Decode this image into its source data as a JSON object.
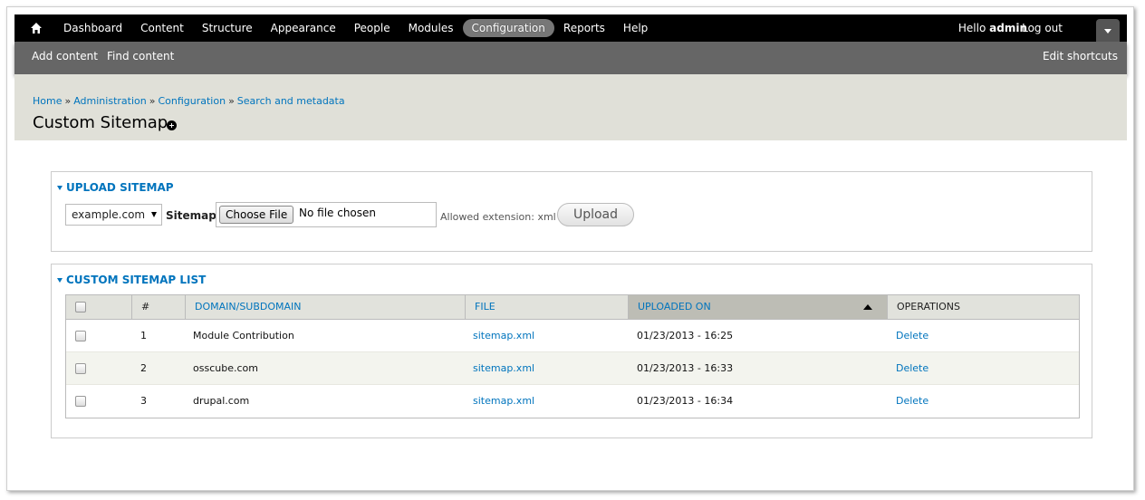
{
  "toolbar": {
    "menu": [
      {
        "label": "Dashboard",
        "active": false
      },
      {
        "label": "Content",
        "active": false
      },
      {
        "label": "Structure",
        "active": false
      },
      {
        "label": "Appearance",
        "active": false
      },
      {
        "label": "People",
        "active": false
      },
      {
        "label": "Modules",
        "active": false
      },
      {
        "label": "Configuration",
        "active": true
      },
      {
        "label": "Reports",
        "active": false
      },
      {
        "label": "Help",
        "active": false
      }
    ],
    "hello": "Hello",
    "username": "admin",
    "logout": "Log out",
    "home_icon": "home-icon",
    "toggle_icon": "chevron-down-icon"
  },
  "shortcuts": {
    "add_content": "Add content",
    "find_content": "Find content",
    "edit_shortcuts": "Edit shortcuts"
  },
  "breadcrumb": [
    "Home",
    "Administration",
    "Configuration",
    "Search and metadata"
  ],
  "breadcrumb_sep": "»",
  "page_title": "Custom Sitemap",
  "upload": {
    "legend": "UPLOAD SITEMAP",
    "domain_selected": "example.com",
    "sitemap_label": "Sitemap",
    "choose_file": "Choose File",
    "no_file": "No file chosen",
    "allowed": "Allowed extension: xml",
    "upload_button": "Upload"
  },
  "list": {
    "legend": "CUSTOM SITEMAP LIST",
    "headers": {
      "num": "#",
      "domain": "DOMAIN/SUBDOMAIN",
      "file": "FILE",
      "uploaded": "UPLOADED ON",
      "operations": "OPERATIONS"
    },
    "rows": [
      {
        "num": "1",
        "domain": "Module Contribution",
        "file": "sitemap.xml",
        "uploaded": "01/23/2013 - 16:25",
        "op": "Delete"
      },
      {
        "num": "2",
        "domain": "osscube.com",
        "file": "sitemap.xml",
        "uploaded": "01/23/2013 - 16:33",
        "op": "Delete"
      },
      {
        "num": "3",
        "domain": "drupal.com",
        "file": "sitemap.xml",
        "uploaded": "01/23/2013 - 16:34",
        "op": "Delete"
      }
    ]
  },
  "colors": {
    "link": "#0074bd",
    "toolbar": "#000000",
    "shortcut_bar": "#666666",
    "header_bg": "#e0e0d8"
  }
}
